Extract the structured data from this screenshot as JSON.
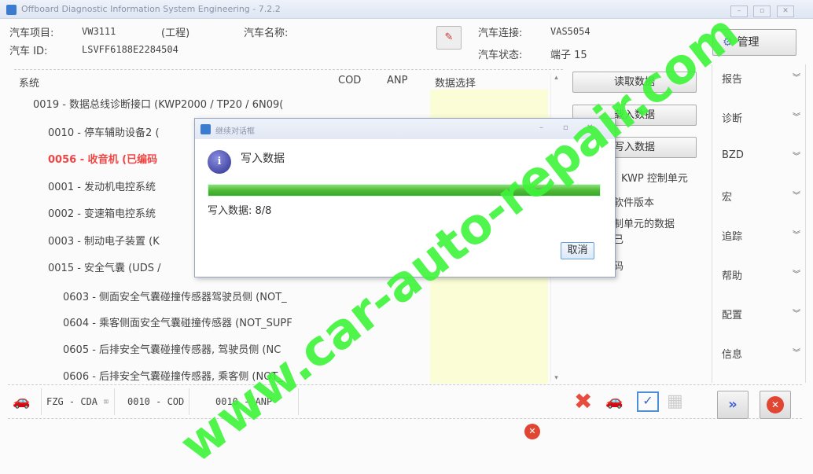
{
  "window": {
    "title": "Offboard Diagnostic Information System Engineering - 7.2.2",
    "controls": [
      "–",
      "▫",
      "✕"
    ]
  },
  "header": {
    "project_label": "汽车项目:",
    "project_value": "VW3111",
    "project_mode": "(工程)",
    "name_label": "汽车名称:",
    "id_label": "汽车 ID:",
    "id_value": "LSVFF6188E2284504",
    "connection_label": "汽车连接:",
    "connection_value": "VAS5054",
    "status_label": "汽车状态:",
    "status_value": "端子 15",
    "manage_label": "管理"
  },
  "table": {
    "columns": [
      "系统",
      "COD",
      "ANP",
      "数据选择"
    ],
    "rows": [
      {
        "text": "0019 - 数据总线诊断接口 (KWP2000 / TP20 / 6N09(",
        "level": 1,
        "highlight": false
      },
      {
        "text": "0010 - 停车辅助设备2 (",
        "level": 2,
        "highlight": false
      },
      {
        "text": "0056 - 收音机 (已编码",
        "level": 2,
        "highlight": true
      },
      {
        "text": "0001 - 发动机电控系统",
        "level": 2,
        "highlight": false
      },
      {
        "text": "0002 - 变速箱电控系统",
        "level": 2,
        "highlight": false
      },
      {
        "text": "0003 - 制动电子装置 (K",
        "level": 2,
        "highlight": false
      },
      {
        "text": "0015 - 安全气囊 (UDS /",
        "level": 2,
        "highlight": false
      },
      {
        "text": "0603 - 侧面安全气囊碰撞传感器驾驶员侧 (NOT_",
        "level": 3,
        "highlight": false
      },
      {
        "text": "0604 - 乘客侧面安全气囊碰撞传感器 (NOT_SUPF",
        "level": 3,
        "highlight": false
      },
      {
        "text": "0605 - 后排安全气囊碰撞传感器, 驾驶员侧 (NC",
        "level": 3,
        "highlight": false
      },
      {
        "text": "0606 - 后排安全气囊碰撞传感器, 乘客侧 (NOT_",
        "level": 3,
        "highlight": false
      }
    ]
  },
  "actions": {
    "read": "读取数据",
    "load": "载入数据",
    "write": "写入数据"
  },
  "info_lines": [
    "KWP 控制单元",
    "软件版本",
    "制单元的数据",
    "已",
    "码"
  ],
  "sidebar": {
    "items": [
      "报告",
      "诊断",
      "BZD",
      "宏",
      "追踪",
      "帮助",
      "配置",
      "信息"
    ]
  },
  "bottom_tabs": [
    "FZG - CDA",
    "0010 - COD",
    "0010 - ANP"
  ],
  "tab_close": "⌧",
  "dialog": {
    "title": "继续对话框",
    "heading": "写入数据",
    "progress_label": "写入数据: 8/8",
    "progress": 1.0,
    "cancel": "取消",
    "controls": [
      "–",
      "▫",
      "✕"
    ]
  },
  "watermark": "www.car-auto-repair.com",
  "colors": {
    "progress": "#4fbb36",
    "highlight_row": "#f04545",
    "data_column": "#fbfdd6"
  }
}
